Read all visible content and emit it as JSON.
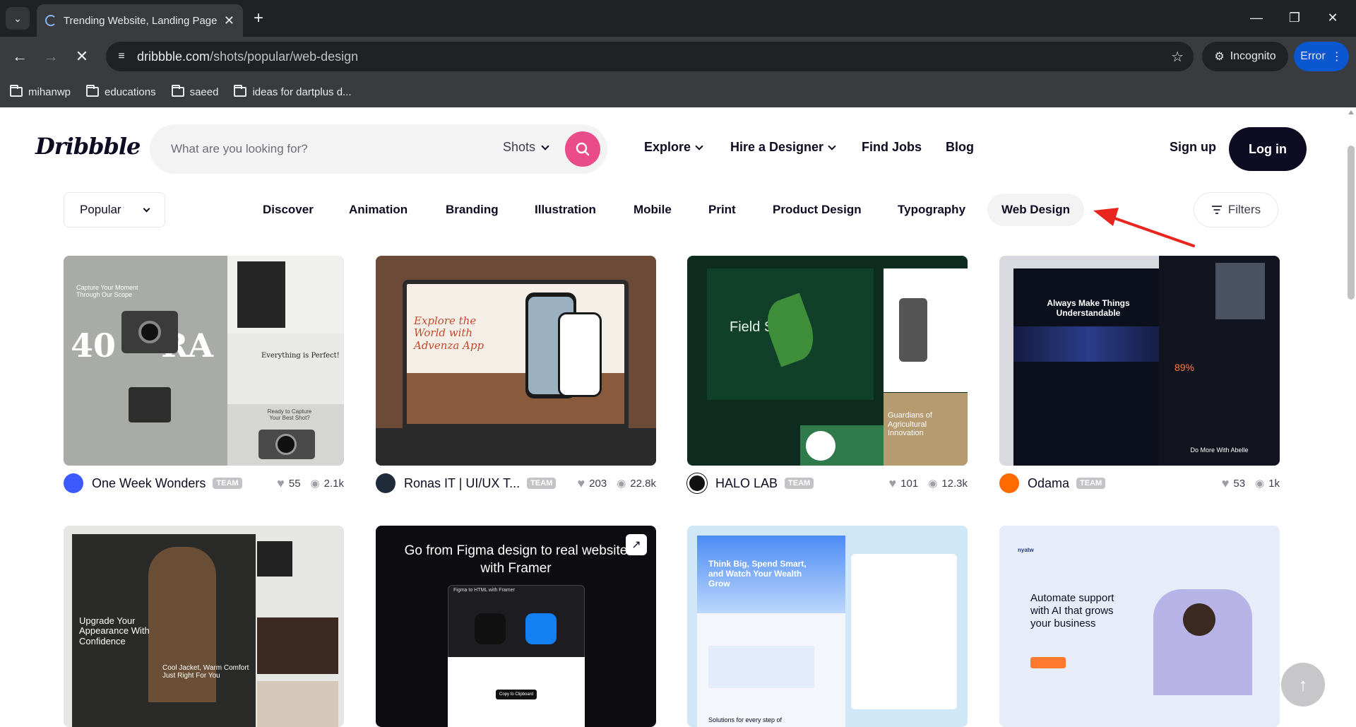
{
  "browser": {
    "tab_title": "Trending Website, Landing Page",
    "new_tab_icon": "+",
    "url_host": "dribbble.com",
    "url_path": "/shots/popular/web-design",
    "incognito_label": "Incognito",
    "error_label": "Error",
    "bookmarks": [
      "mihanwp",
      "educations",
      "saeed",
      "ideas for dartplus d..."
    ]
  },
  "header": {
    "logo": "Dribbble",
    "search_placeholder": "What are you looking for?",
    "search_scope": "Shots",
    "nav": [
      "Explore",
      "Hire a Designer",
      "Find Jobs",
      "Blog"
    ],
    "signup": "Sign up",
    "login": "Log in"
  },
  "filterbar": {
    "sort": "Popular",
    "categories": [
      "Discover",
      "Animation",
      "Branding",
      "Illustration",
      "Mobile",
      "Print",
      "Product Design",
      "Typography",
      "Web Design"
    ],
    "active_category": "Web Design",
    "filters_label": "Filters"
  },
  "shots": [
    {
      "author": "One Week Wonders",
      "badge": "TEAM",
      "likes": "55",
      "views": "2.1k",
      "avatar_color": "#3d5afe"
    },
    {
      "author": "Ronas IT | UI/UX T...",
      "badge": "TEAM",
      "likes": "203",
      "views": "22.8k",
      "avatar_color": "#1f2a3a"
    },
    {
      "author": "HALO LAB",
      "badge": "TEAM",
      "likes": "101",
      "views": "12.3k",
      "avatar_color": "#111111"
    },
    {
      "author": "Odama",
      "badge": "TEAM",
      "likes": "53",
      "views": "1k",
      "avatar_color": "#ff6a00"
    }
  ],
  "shot_texts": {
    "s1_hero": "Capture Your Moment Through Our Scope",
    "s1_perfect": "Everything is Perfect!",
    "s1_ready": "Ready to Capture Your Best Shot?",
    "s2_hero": "Explore the World with Advenza App",
    "s3_hero": "Field Shield",
    "s3_green": "Guardians of Agricultural Innovation",
    "s4_hero": "Always Make Things Understandable",
    "s4_sub": "Do More With Abelle",
    "s5_hero": "Upgrade Your Appearance With Confidence",
    "s5_jacket": "Cool Jacket, Warm Comfort Just Right For You",
    "s6_title": "Go from Figma design to real website with Framer",
    "s6_dialog": "Figma to HTML with Framer",
    "s6_copy": "Copy to Clipboard",
    "s7_hero": "Think Big, Spend Smart, and Watch Your Wealth Grow",
    "s7_sub": "Solutions for every step of",
    "s8_hero": "Automate support with AI that grows your business",
    "s8_brand": "nyatw"
  },
  "colors": {
    "accent": "#ea4c89",
    "dark": "#0d0c22",
    "annotation_arrow": "#e8251f"
  }
}
